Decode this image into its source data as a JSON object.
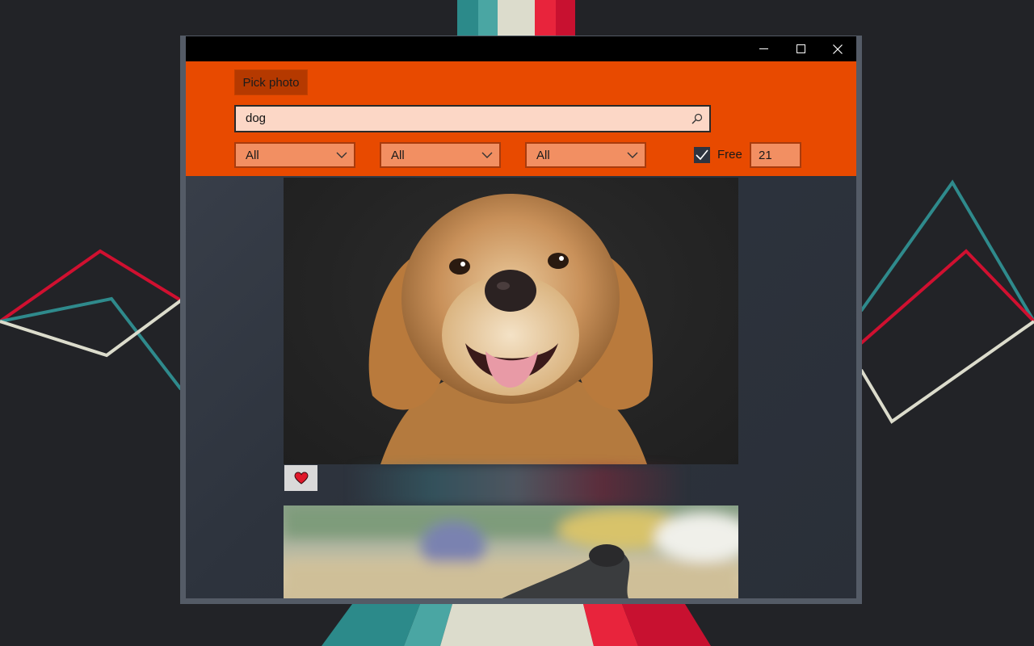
{
  "window": {
    "caption_buttons": [
      "minimize-icon",
      "maximize-icon",
      "close-icon"
    ]
  },
  "header": {
    "pick_photo_label": "Pick photo",
    "search_value": "dog",
    "search_icon": "search-icon",
    "filters": [
      "All",
      "All",
      "All"
    ],
    "free_checked": true,
    "free_label": "Free",
    "count_value": "21"
  },
  "feed": {
    "items": [
      {
        "subject": "golden retriever portrait",
        "like_icon": "heart-icon"
      },
      {
        "subject": "dog nose on blurred background"
      }
    ]
  },
  "colors": {
    "accent": "#e84a00",
    "pick_button": "#b53900",
    "search_fill": "#fcd7c6",
    "dropdown_fill": "#f28f62",
    "heart": "#e0182a"
  }
}
